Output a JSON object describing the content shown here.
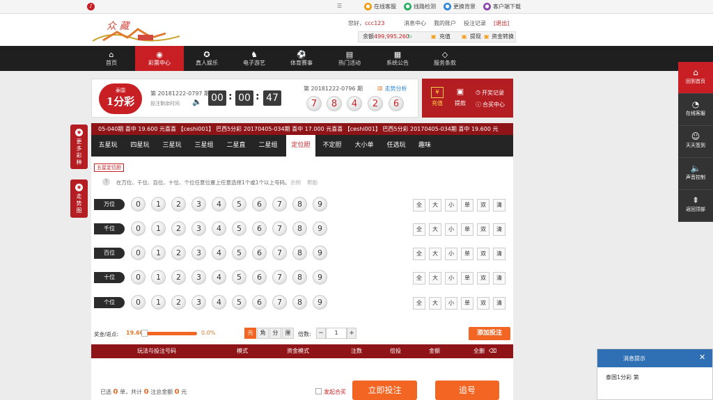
{
  "topbar": {
    "online_service": "在线客服",
    "line_check": "线路检测",
    "change_bg": "更换背景",
    "client_download": "客户端下载"
  },
  "header": {
    "greeting": "您好，",
    "username": "ccc123",
    "links": [
      "消息中心",
      "我的账户",
      "投注记录",
      "[退出]"
    ],
    "balance_label": "余额",
    "balance_value": "499,995.260",
    "deposit": "充值",
    "withdraw": "提现",
    "transfer": "资金转换"
  },
  "nav": [
    {
      "icon": "home-icon",
      "label": "首页"
    },
    {
      "icon": "lottery-icon",
      "label": "彩票中心",
      "active": true
    },
    {
      "icon": "casino-icon",
      "label": "真人娱乐"
    },
    {
      "icon": "game-icon",
      "label": "电子游艺"
    },
    {
      "icon": "sports-icon",
      "label": "体育赛事"
    },
    {
      "icon": "gift-icon",
      "label": "热门活动"
    },
    {
      "icon": "notice-icon",
      "label": "系统公告"
    },
    {
      "icon": "diamond-icon",
      "label": "服务条款"
    }
  ],
  "lottery": {
    "logo_top": "泰国",
    "logo_main": "1分彩",
    "current_issue": "第 20181222-0797 期",
    "countdown_label": "投注剩余时间",
    "timer": [
      "00",
      "00",
      "47"
    ],
    "last_issue": "第 20181222-0796 期",
    "trend": "走势分析",
    "last_numbers": [
      "7",
      "8",
      "4",
      "2",
      "6"
    ]
  },
  "wallet": {
    "recharge": "充值",
    "withdraw": "提款",
    "draw_record": "开奖记录",
    "help_center": "合买中心"
  },
  "ticker": "05-040期 喜中 19.600 元喜喜 【ceshi001】 巴西5分彩 20170405-034期 喜中 17.000 元喜喜 【ceshi001】 巴西5分彩 20170405-034期 喜中 19.600 元",
  "left_float": {
    "more": "更多彩种",
    "trend": "走势图"
  },
  "tabs": [
    "五星玩",
    "四星玩",
    "三星玩",
    "三星组",
    "二星直",
    "二星组",
    "定位胆",
    "不定胆",
    "大小单",
    "任选玩",
    "趣味"
  ],
  "active_tab": "定位胆",
  "play": {
    "sub_tag": "五星定位胆",
    "hint": "在万位、千位、百位、十位、个位任意位置上任意选择1个或1个以上号码。",
    "example": "示例",
    "help": "帮助"
  },
  "rows": [
    "万位",
    "千位",
    "百位",
    "十位",
    "个位"
  ],
  "digits": [
    "0",
    "1",
    "2",
    "3",
    "4",
    "5",
    "6",
    "7",
    "8",
    "9"
  ],
  "quick": [
    "全",
    "大",
    "小",
    "单",
    "双",
    "清"
  ],
  "odds": {
    "label": "奖金/返点:",
    "value": "19.60",
    "rebate": "0.0%",
    "units": [
      "元",
      "角",
      "分",
      "厘"
    ],
    "multiple_label": "倍数:",
    "multiple_value": "1",
    "add_bet": "添加投注"
  },
  "bet_table": {
    "headers": [
      "玩法与投注号码",
      "模式",
      "资金模式",
      "注数",
      "倍投",
      "金额",
      "全删"
    ]
  },
  "bottom": {
    "selected_prefix": "已选",
    "selected_count": "0",
    "selected_unit": "单，共计",
    "total_bets": "0",
    "total_label": "注总金额",
    "total_amount": "0",
    "yuan": "元",
    "group_buy": "发起合买",
    "bet_now": "立即投注",
    "chase": "追号"
  },
  "right_bar": [
    {
      "icon": "home-icon",
      "label": "回到首页"
    },
    {
      "icon": "service-24h-icon",
      "label": "在线客服"
    },
    {
      "icon": "sign-icon",
      "label": "天天签到"
    },
    {
      "icon": "sound-icon",
      "label": "声音控制"
    },
    {
      "icon": "top-icon",
      "label": "返回顶部"
    }
  ],
  "popup": {
    "title": "消息提示",
    "content": "泰国1分彩 第"
  },
  "colors": {
    "brand_red": "#c71f24",
    "dark": "#1f1f1f",
    "accent_orange": "#f26522"
  }
}
